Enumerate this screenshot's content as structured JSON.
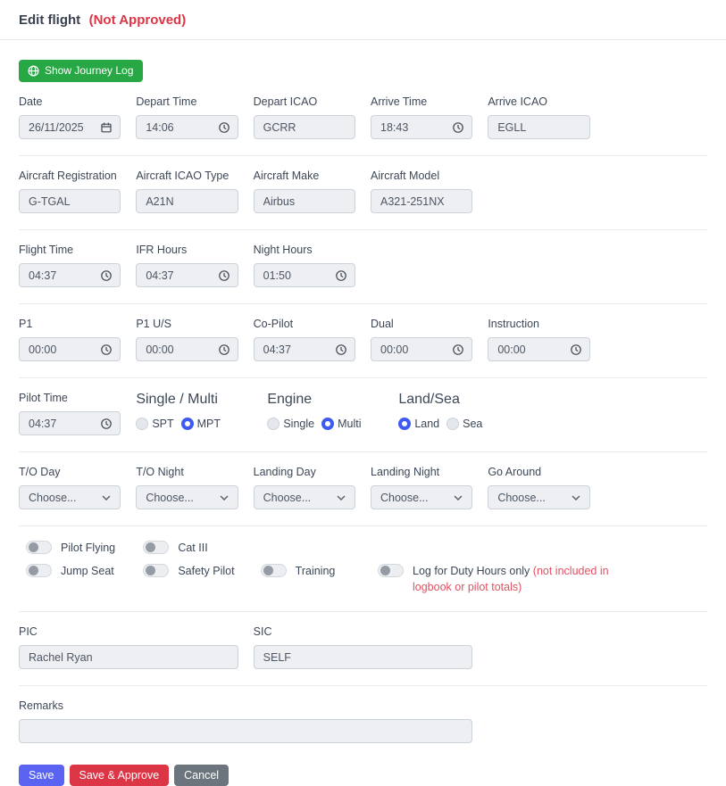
{
  "colors": {
    "radio_accent": "#3d5af1",
    "save_blue": "#5a63f2",
    "danger_red": "#dc3545",
    "success_green": "#28a745",
    "cancel_gray": "#6c757d",
    "input_bg": "#edeff3"
  },
  "header": {
    "title": "Edit flight",
    "status": "(Not Approved)"
  },
  "journey": {
    "button_label": "Show Journey Log"
  },
  "schedule": {
    "date": {
      "label": "Date",
      "value": "26/11/2025"
    },
    "depart_time": {
      "label": "Depart Time",
      "value": "14:06"
    },
    "depart_icao": {
      "label": "Depart ICAO",
      "value": "GCRR"
    },
    "arrive_time": {
      "label": "Arrive Time",
      "value": "18:43"
    },
    "arrive_icao": {
      "label": "Arrive ICAO",
      "value": "EGLL"
    }
  },
  "aircraft": {
    "registration": {
      "label": "Aircraft Registration",
      "value": "G-TGAL"
    },
    "icao_type": {
      "label": "Aircraft ICAO Type",
      "value": "A21N"
    },
    "make": {
      "label": "Aircraft Make",
      "value": "Airbus"
    },
    "model": {
      "label": "Aircraft Model",
      "value": "A321-251NX"
    }
  },
  "hours": {
    "flight_time": {
      "label": "Flight Time",
      "value": "04:37"
    },
    "ifr_hours": {
      "label": "IFR Hours",
      "value": "04:37"
    },
    "night_hours": {
      "label": "Night Hours",
      "value": "01:50"
    }
  },
  "crew_time": {
    "p1": {
      "label": "P1",
      "value": "00:00"
    },
    "p1_us": {
      "label": "P1 U/S",
      "value": "00:00"
    },
    "co_pilot": {
      "label": "Co-Pilot",
      "value": "04:37"
    },
    "dual": {
      "label": "Dual",
      "value": "00:00"
    },
    "instruction": {
      "label": "Instruction",
      "value": "00:00"
    }
  },
  "pilot_time": {
    "label": "Pilot Time",
    "value": "04:37"
  },
  "radio_groups": {
    "single_multi": {
      "label": "Single / Multi",
      "options": [
        {
          "label": "SPT",
          "selected": false
        },
        {
          "label": "MPT",
          "selected": true
        }
      ]
    },
    "engine": {
      "label": "Engine",
      "options": [
        {
          "label": "Single",
          "selected": false
        },
        {
          "label": "Multi",
          "selected": true
        }
      ]
    },
    "land_sea": {
      "label": "Land/Sea",
      "options": [
        {
          "label": "Land",
          "selected": true
        },
        {
          "label": "Sea",
          "selected": false
        }
      ]
    }
  },
  "movements": {
    "to_day": {
      "label": "T/O Day",
      "value": "Choose..."
    },
    "to_night": {
      "label": "T/O Night",
      "value": "Choose..."
    },
    "landing_day": {
      "label": "Landing Day",
      "value": "Choose..."
    },
    "landing_night": {
      "label": "Landing Night",
      "value": "Choose..."
    },
    "go_around": {
      "label": "Go Around",
      "value": "Choose..."
    }
  },
  "toggles": {
    "pilot_flying": {
      "label": "Pilot Flying",
      "on": false
    },
    "cat_iii": {
      "label": "Cat III",
      "on": false
    },
    "jump_seat": {
      "label": "Jump Seat",
      "on": false
    },
    "safety_pilot": {
      "label": "Safety Pilot",
      "on": false
    },
    "training": {
      "label": "Training",
      "on": false
    },
    "duty_hours": {
      "label": "Log for Duty Hours only",
      "note": "(not included in logbook or pilot totals)",
      "on": false
    }
  },
  "crew": {
    "pic": {
      "label": "PIC",
      "value": "Rachel Ryan"
    },
    "sic": {
      "label": "SIC",
      "value": "SELF"
    }
  },
  "remarks": {
    "label": "Remarks",
    "value": ""
  },
  "actions": {
    "save": "Save",
    "save_approve": "Save & Approve",
    "cancel": "Cancel"
  }
}
